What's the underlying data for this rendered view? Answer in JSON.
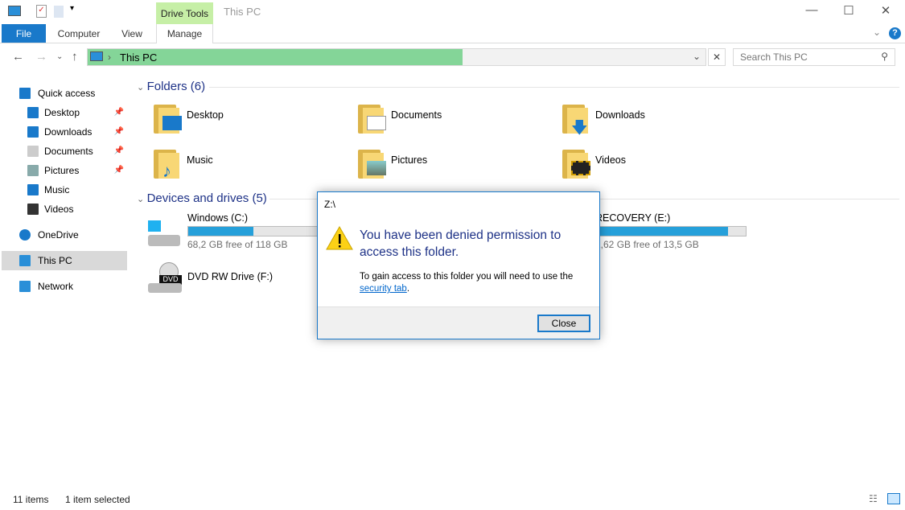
{
  "window": {
    "title": "This PC",
    "context_tab": "Drive Tools"
  },
  "ribbon": {
    "tabs": [
      "File",
      "Computer",
      "View",
      "Manage"
    ]
  },
  "address": {
    "path": "This PC",
    "search_placeholder": "Search This PC"
  },
  "sidebar": {
    "items": [
      {
        "label": "Quick access",
        "icon": "star-icon",
        "pinned": false,
        "sub": false
      },
      {
        "label": "Desktop",
        "icon": "desktop-icon",
        "pinned": true,
        "sub": true
      },
      {
        "label": "Downloads",
        "icon": "download-icon",
        "pinned": true,
        "sub": true
      },
      {
        "label": "Documents",
        "icon": "documents-icon",
        "pinned": true,
        "sub": true
      },
      {
        "label": "Pictures",
        "icon": "pictures-icon",
        "pinned": true,
        "sub": true
      },
      {
        "label": "Music",
        "icon": "music-icon",
        "pinned": false,
        "sub": true
      },
      {
        "label": "Videos",
        "icon": "videos-icon",
        "pinned": false,
        "sub": true
      },
      {
        "label": "OneDrive",
        "icon": "cloud-icon",
        "pinned": false,
        "sub": false
      },
      {
        "label": "This PC",
        "icon": "computer-icon",
        "pinned": false,
        "sub": false,
        "selected": true
      },
      {
        "label": "Network",
        "icon": "network-icon",
        "pinned": false,
        "sub": false
      }
    ]
  },
  "folders": {
    "header": "Folders (6)",
    "items": [
      "Desktop",
      "Documents",
      "Downloads",
      "Music",
      "Pictures",
      "Videos"
    ]
  },
  "drives": {
    "header": "Devices and drives (5)",
    "items": [
      {
        "label": "Windows (C:)",
        "free": "68,2 GB free of 118 GB",
        "used_fraction": 0.42
      },
      {
        "label": "RECOVERY (E:)",
        "free": "1,62 GB free of 13,5 GB",
        "used_fraction": 0.88
      },
      {
        "label": "DVD RW Drive (F:)"
      }
    ]
  },
  "dialog": {
    "title": "Z:\\",
    "message": "You have been denied permission to access this folder.",
    "detail": "To gain access to this folder you will need to use the",
    "link": "security tab",
    "link_suffix": ".",
    "close": "Close"
  },
  "status": {
    "items": "11 items",
    "selected": "1 item selected"
  },
  "colors": {
    "accent": "#1979ca",
    "address_fill": "#84d598",
    "drive_bar": "#26a0da",
    "drive_tools": "#c6efa6"
  }
}
